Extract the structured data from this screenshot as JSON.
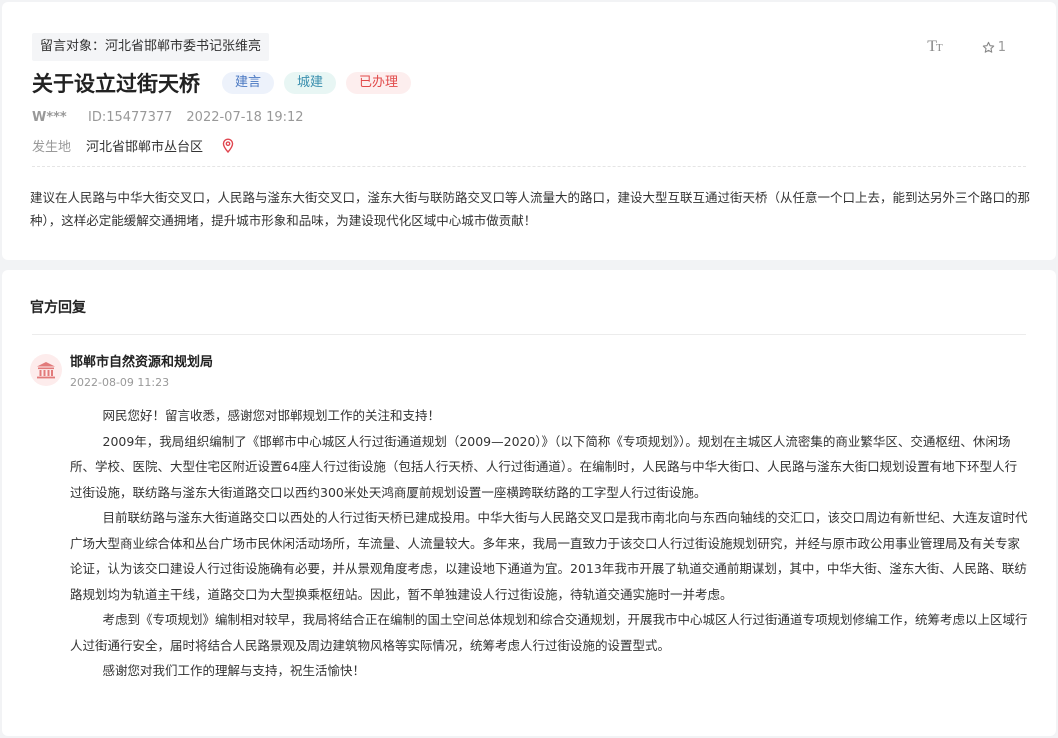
{
  "message": {
    "target_label": "留言对象：河北省邯郸市委书记张维亮",
    "title": "关于设立过街天桥",
    "tags": [
      "建言",
      "城建",
      "已办理"
    ],
    "user": "W***",
    "id": "ID:15477377",
    "datetime": "2022-07-18 19:12",
    "place_label": "发生地",
    "place_value": "河北省邯郸市丛台区",
    "content": "建议在人民路与中华大街交叉口，人民路与滏东大街交叉口，滏东大街与联防路交叉口等人流量大的路口，建设大型互联互通过街天桥（从任意一个口上去，能到达另外三个路口的那种），这样必定能缓解交通拥堵，提升城市形象和品味，为建设现代化区域中心城市做贡献！"
  },
  "tools": {
    "font_icon": "font-size-icon",
    "star_icon": "star-icon",
    "star_count": "1"
  },
  "reply": {
    "heading": "官方回复",
    "org_name": "邯郸市自然资源和规划局",
    "org_icon": "government-building-icon",
    "date": "2022-08-09 11:23",
    "paragraphs": [
      "网民您好！留言收悉，感谢您对邯郸规划工作的关注和支持！",
      "2009年，我局组织编制了《邯郸市中心城区人行过街通道规划（2009—2020）》（以下简称《专项规划》）。规划在主城区人流密集的商业繁华区、交通枢纽、休闲场所、学校、医院、大型住宅区附近设置64座人行过街设施（包括人行天桥、人行过街通道）。在编制时，人民路与中华大街口、人民路与滏东大街口规划设置有地下环型人行过街设施，联纺路与滏东大街道路交口以西约300米处天鸿商厦前规划设置一座横跨联纺路的工字型人行过街设施。",
      "目前联纺路与滏东大街道路交口以西处的人行过街天桥已建成投用。中华大街与人民路交叉口是我市南北向与东西向轴线的交汇口，该交口周边有新世纪、大连友谊时代广场大型商业综合体和丛台广场市民休闲活动场所，车流量、人流量较大。多年来，我局一直致力于该交口人行过街设施规划研究，并经与原市政公用事业管理局及有关专家论证，认为该交口建设人行过街设施确有必要，并从景观角度考虑，以建设地下通道为宜。2013年我市开展了轨道交通前期谋划，其中，中华大街、滏东大街、人民路、联纺路规划均为轨道主干线，道路交口为大型换乘枢纽站。因此，暂不单独建设人行过街设施，待轨道交通实施时一并考虑。",
      "考虑到《专项规划》编制相对较早，我局将结合正在编制的国土空间总体规划和综合交通规划，开展我市中心城区人行过街通道专项规划修编工作，统筹考虑以上区域行人过街通行安全，届时将结合人民路景观及周边建筑物风格等实际情况，统筹考虑人行过街设施的设置型式。",
      "感谢您对我们工作的理解与支持，祝生活愉快！"
    ]
  },
  "colors": {
    "tag_blue": "#4a78c2",
    "tag_green": "#3a8fae",
    "tag_red": "#e14b4b",
    "pin": "#e0454f",
    "org_icon": "#e27a7a"
  }
}
